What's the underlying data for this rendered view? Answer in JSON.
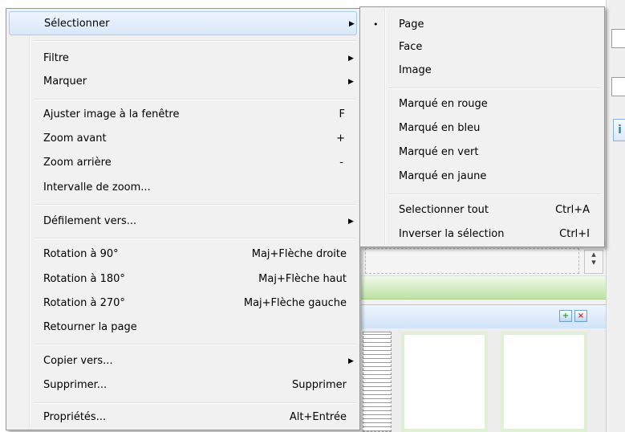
{
  "main_menu": {
    "items": [
      {
        "label": "Sélectionner",
        "shortcut": "",
        "submenu": true
      },
      {
        "label": "Filtre",
        "shortcut": "",
        "submenu": true
      },
      {
        "label": "Marquer",
        "shortcut": "",
        "submenu": true
      },
      {
        "label": "Ajuster image à la fenêtre",
        "shortcut": "F",
        "submenu": false
      },
      {
        "label": "Zoom avant",
        "shortcut": "+",
        "submenu": false
      },
      {
        "label": "Zoom arrière",
        "shortcut": "-",
        "submenu": false
      },
      {
        "label": "Intervalle de zoom...",
        "shortcut": "",
        "submenu": false
      },
      {
        "label": "Défilement vers...",
        "shortcut": "",
        "submenu": true
      },
      {
        "label": "Rotation à 90°",
        "shortcut": "Maj+Flèche droite",
        "submenu": false
      },
      {
        "label": "Rotation à 180°",
        "shortcut": "Maj+Flèche haut",
        "submenu": false
      },
      {
        "label": "Rotation à 270°",
        "shortcut": "Maj+Flèche gauche",
        "submenu": false
      },
      {
        "label": "Retourner la page",
        "shortcut": "",
        "submenu": false
      },
      {
        "label": "Copier vers...",
        "shortcut": "",
        "submenu": true
      },
      {
        "label": "Supprimer...",
        "shortcut": "Supprimer",
        "submenu": false
      },
      {
        "label": "Propriétés...",
        "shortcut": "Alt+Entrée",
        "submenu": false
      }
    ],
    "highlighted_item": "Sélectionner"
  },
  "submenu": {
    "items": [
      {
        "label": "Page",
        "shortcut": "",
        "checked": true
      },
      {
        "label": "Face",
        "shortcut": "",
        "checked": false
      },
      {
        "label": "Image",
        "shortcut": "",
        "checked": false
      },
      {
        "label": "Marqué en rouge",
        "shortcut": "",
        "checked": false
      },
      {
        "label": "Marqué en bleu",
        "shortcut": "",
        "checked": false
      },
      {
        "label": "Marqué en vert",
        "shortcut": "",
        "checked": false
      },
      {
        "label": "Marqué en jaune",
        "shortcut": "",
        "checked": false
      },
      {
        "label": "Selectionner tout",
        "shortcut": "Ctrl+A",
        "checked": false
      },
      {
        "label": "Inverser la sélection",
        "shortcut": "Ctrl+I",
        "checked": false
      }
    ],
    "bullet": "•"
  },
  "glyphs": {
    "submenu_arrow": "▶",
    "scroll_down": "▾",
    "scroll_up": "▴",
    "info": "i",
    "add_icon": "+",
    "remove_icon": "×"
  },
  "colors": {
    "menu_bg": "#f1f1f1",
    "highlight_border": "#a8cbef",
    "green_bar": "#bde3a4",
    "blue_bar": "#cfe3f7"
  }
}
